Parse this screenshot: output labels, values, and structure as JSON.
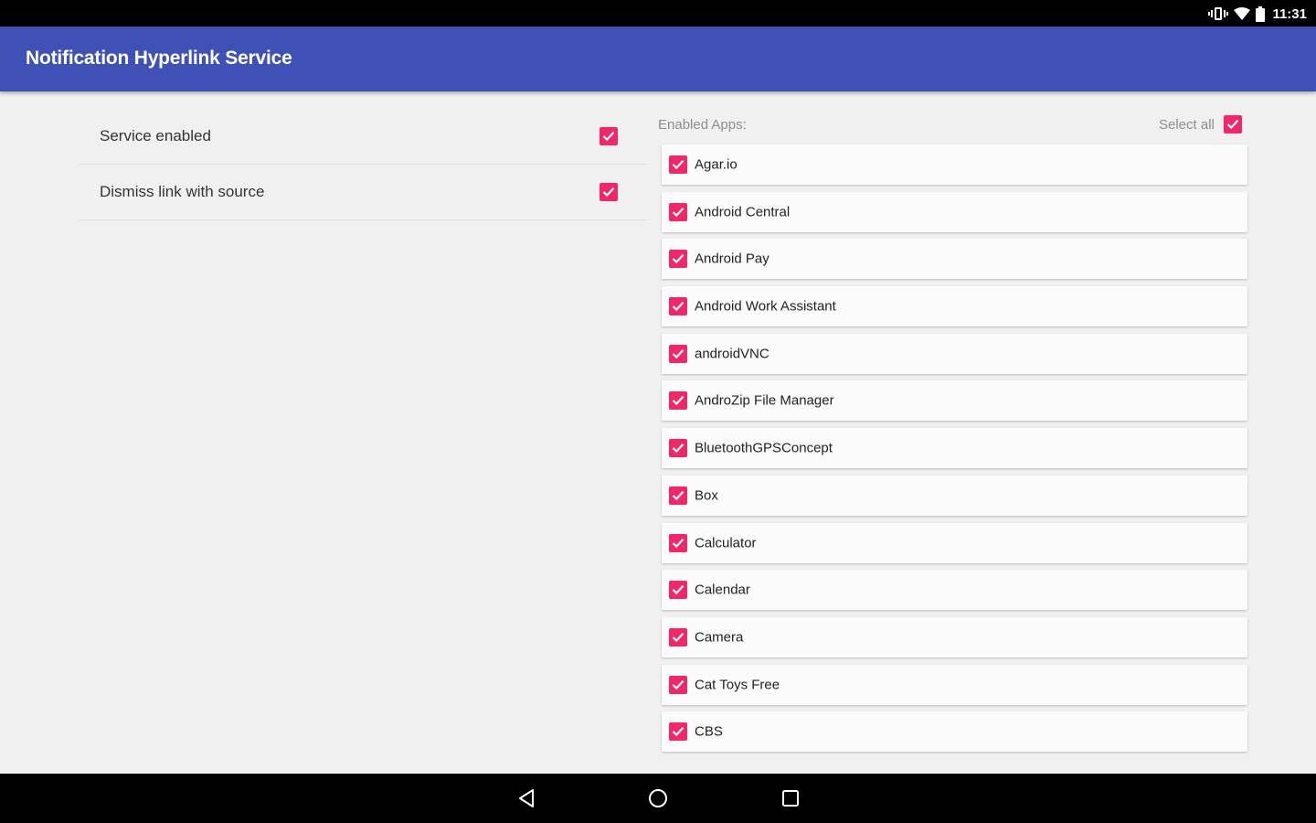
{
  "status_bar": {
    "time": "11:31",
    "icons": [
      "vibrate-icon",
      "wifi-icon",
      "battery-icon"
    ]
  },
  "app_bar": {
    "title": "Notification Hyperlink Service",
    "color": "#3f51b5"
  },
  "settings": [
    {
      "label": "Service enabled",
      "checked": true
    },
    {
      "label": "Dismiss link with source",
      "checked": true
    }
  ],
  "apps_panel": {
    "header_label": "Enabled Apps:",
    "select_all_label": "Select all",
    "select_all_checked": true,
    "apps": [
      {
        "name": "Agar.io",
        "checked": true
      },
      {
        "name": "Android Central",
        "checked": true
      },
      {
        "name": "Android Pay",
        "checked": true
      },
      {
        "name": "Android Work Assistant",
        "checked": true
      },
      {
        "name": "androidVNC",
        "checked": true
      },
      {
        "name": "AndroZip File Manager",
        "checked": true
      },
      {
        "name": "BluetoothGPSConcept",
        "checked": true
      },
      {
        "name": "Box",
        "checked": true
      },
      {
        "name": "Calculator",
        "checked": true
      },
      {
        "name": "Calendar",
        "checked": true
      },
      {
        "name": "Camera",
        "checked": true
      },
      {
        "name": "Cat Toys Free",
        "checked": true
      },
      {
        "name": "CBS",
        "checked": true
      }
    ]
  },
  "nav_bar": {
    "buttons": [
      "back-icon",
      "home-icon",
      "recents-icon"
    ]
  },
  "colors": {
    "accent": "#f0286a",
    "primary": "#3f51b5",
    "background": "#f0f0f0"
  }
}
